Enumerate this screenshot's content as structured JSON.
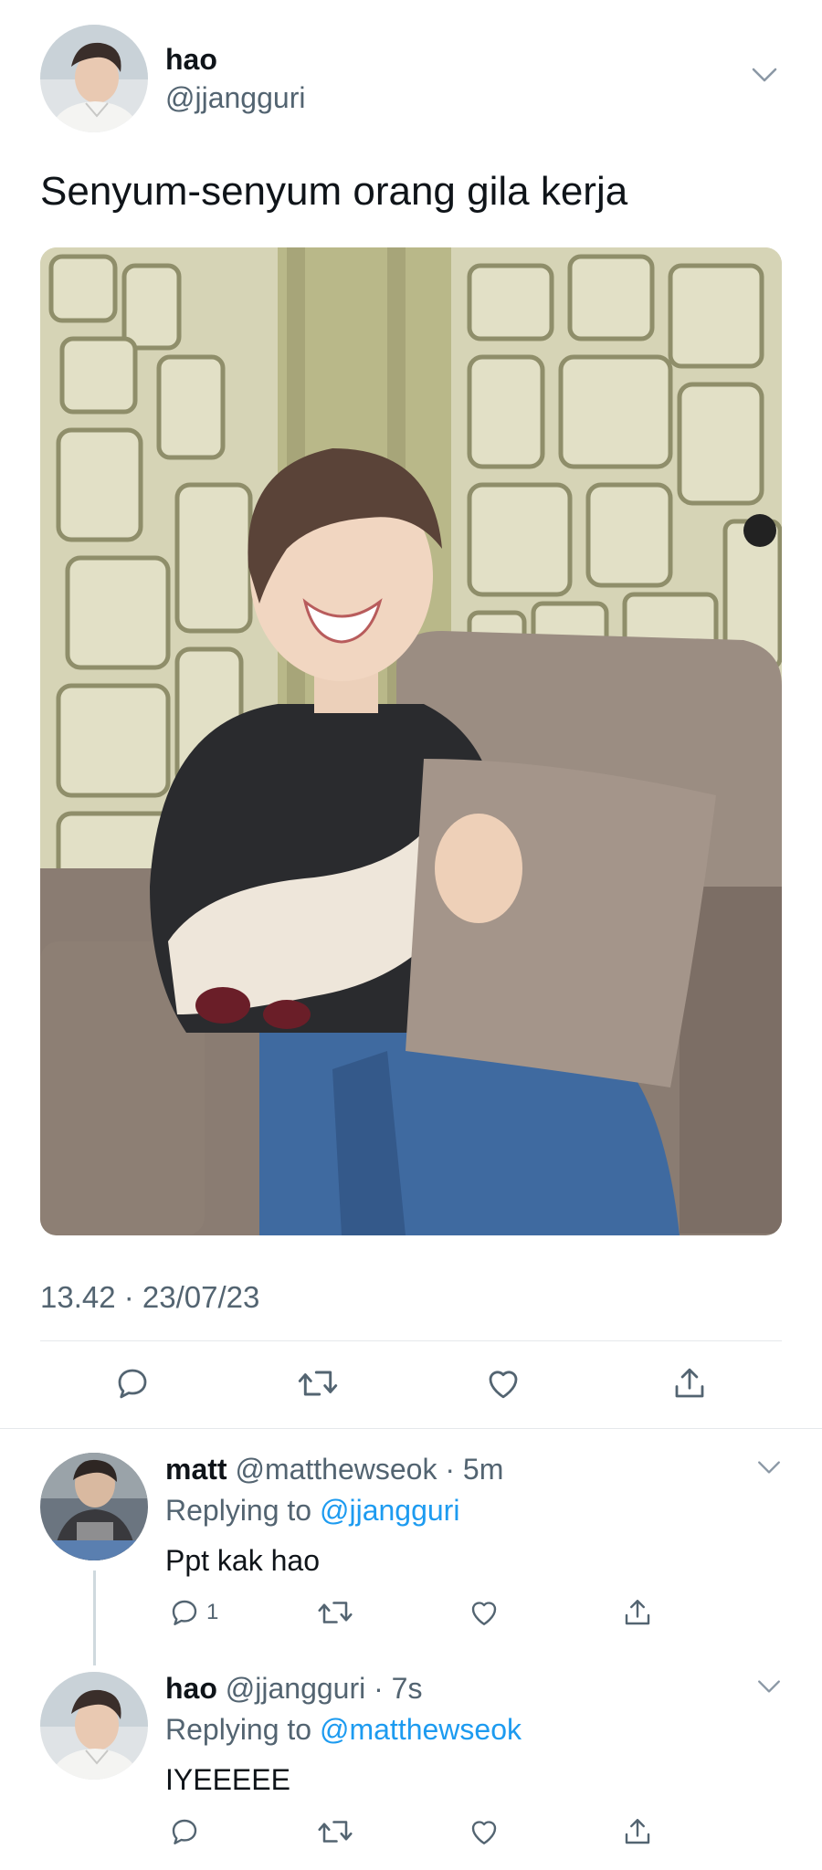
{
  "main_tweet": {
    "name": "hao",
    "handle": "@jjangguri",
    "text": "Senyum-senyum orang gila kerja",
    "timestamp": "13.42 · 23/07/23",
    "actions": [
      "reply-icon",
      "retweet-icon",
      "like-icon",
      "share-icon"
    ]
  },
  "replies": [
    {
      "name": "matt",
      "handle": "@matthewseok",
      "time": "5m",
      "replying_label": "Replying to",
      "replying_to": "@jjangguri",
      "text": "Ppt kak hao",
      "reply_count": "1"
    },
    {
      "name": "hao",
      "handle": "@jjangguri",
      "time": "7s",
      "replying_label": "Replying to",
      "replying_to": "@matthewseok",
      "text": "IYEEEEE",
      "reply_count": ""
    }
  ],
  "colors": {
    "link": "#1d9bf0",
    "secondary": "#536471",
    "text": "#0f1419",
    "divider": "#e5e8eb"
  }
}
